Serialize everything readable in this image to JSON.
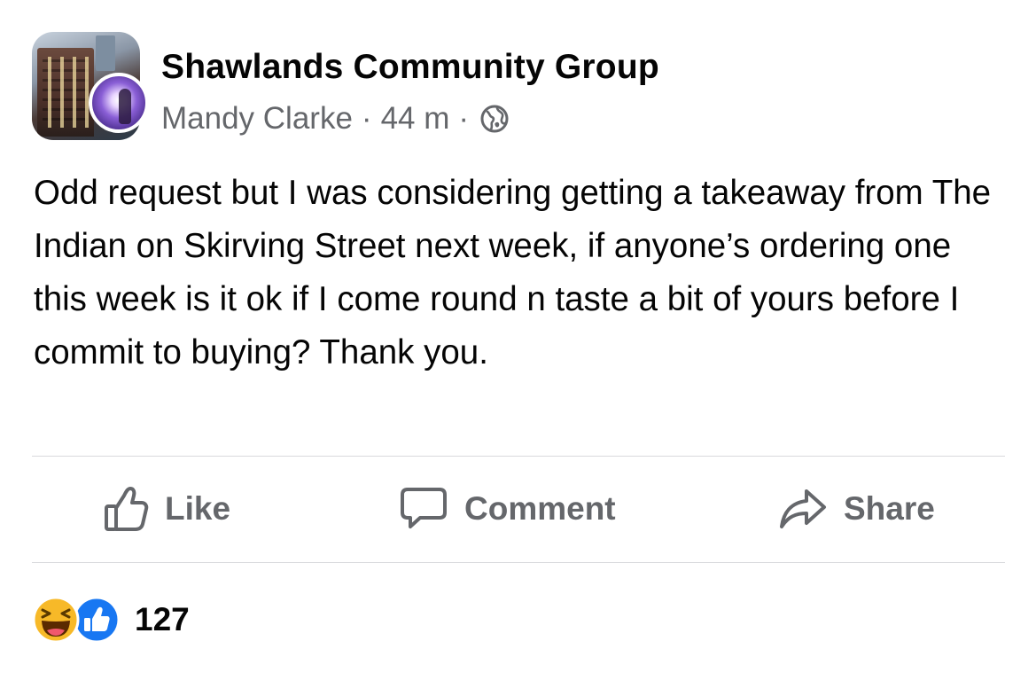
{
  "post": {
    "group_name": "Shawlands Community Group",
    "author": "Mandy Clarke",
    "separator": "·",
    "time": "44 m",
    "separator2": "·",
    "privacy_icon": "globe-icon",
    "text": "Odd request but I was considering getting a takeaway from The Indian on Skirving Street next week, if anyone’s ordering one this week is it ok if I come round n taste a bit of yours before I commit to buying? Thank you."
  },
  "actions": {
    "like_label": "Like",
    "like_icon": "thumbs-up-outline-icon",
    "comment_label": "Comment",
    "comment_icon": "speech-bubble-icon",
    "share_label": "Share",
    "share_icon": "share-arrow-icon"
  },
  "reactions": {
    "icons": [
      "haha-reaction-icon",
      "like-reaction-icon"
    ],
    "count": "127"
  },
  "colors": {
    "text": "#050505",
    "secondary_text": "#65676b",
    "divider": "#d9dadd",
    "like_blue": "#1877f2",
    "haha_yellow": "#f7b928"
  }
}
